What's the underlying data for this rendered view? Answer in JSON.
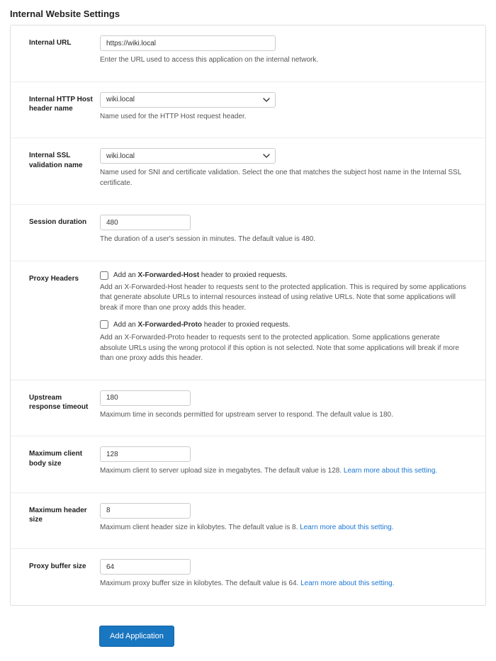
{
  "page_title": "Internal Website Settings",
  "sections": {
    "internal_url": {
      "label": "Internal URL",
      "value": "https://wiki.local",
      "help": "Enter the URL used to access this application on the internal network."
    },
    "http_host": {
      "label": "Internal HTTP Host header name",
      "value": "wiki.local",
      "help": "Name used for the HTTP Host request header."
    },
    "ssl_validation": {
      "label": "Internal SSL validation name",
      "value": "wiki.local",
      "help": "Name used for SNI and certificate validation. Select the one that matches the subject host name in the Internal SSL certificate."
    },
    "session_duration": {
      "label": "Session duration",
      "value": "480",
      "help": "The duration of a user's session in minutes. The default value is 480."
    },
    "proxy_headers": {
      "label": "Proxy Headers",
      "xfh_prefix": "Add an ",
      "xfh_bold": "X-Forwarded-Host",
      "xfh_suffix": " header to proxied requests.",
      "xfh_help": "Add an X-Forwarded-Host header to requests sent to the protected application. This is required by some applications that generate absolute URLs to internal resources instead of using relative URLs. Note that some applications will break if more than one proxy adds this header.",
      "xfp_prefix": "Add an ",
      "xfp_bold": "X-Forwarded-Proto",
      "xfp_suffix": " header to proxied requests.",
      "xfp_help": "Add an X-Forwarded-Proto header to requests sent to the protected application. Some applications generate absolute URLs using the wrong protocol if this option is not selected. Note that some applications will break if more than one proxy adds this header."
    },
    "upstream_timeout": {
      "label": "Upstream response timeout",
      "value": "180",
      "help": "Maximum time in seconds permitted for upstream server to respond. The default value is 180."
    },
    "max_client_body": {
      "label": "Maximum client body size",
      "value": "128",
      "help": "Maximum client to server upload size in megabytes. The default value is 128. ",
      "link": "Learn more about this setting."
    },
    "max_header": {
      "label": "Maximum header size",
      "value": "8",
      "help": "Maximum client header size in kilobytes. The default value is 8. ",
      "link": "Learn more about this setting."
    },
    "proxy_buffer": {
      "label": "Proxy buffer size",
      "value": "64",
      "help": "Maximum proxy buffer size in kilobytes. The default value is 64. ",
      "link": "Learn more about this setting."
    }
  },
  "submit_label": "Add Application"
}
